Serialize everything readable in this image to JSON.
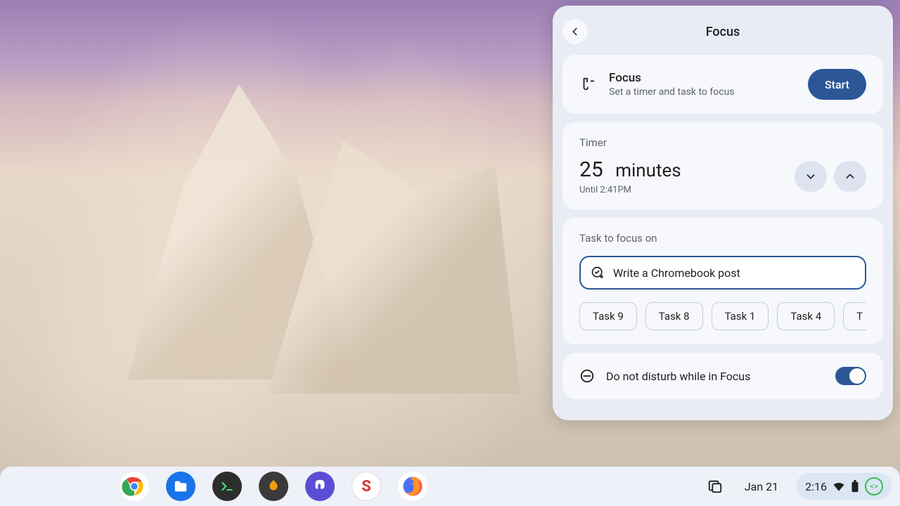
{
  "panel": {
    "title": "Focus"
  },
  "focus": {
    "title": "Focus",
    "subtitle": "Set a timer and task to focus",
    "start_label": "Start"
  },
  "timer": {
    "label": "Timer",
    "value": "25",
    "unit": "minutes",
    "until": "Until 2:41PM"
  },
  "task": {
    "label": "Task to focus on",
    "value": "Write a Chromebook post",
    "chips": [
      "Task 9",
      "Task 8",
      "Task 1",
      "Task 4",
      "T"
    ]
  },
  "dnd": {
    "label": "Do not disturb while in Focus",
    "on": true
  },
  "shelf": {
    "date": "Jan 21",
    "time": "2:16",
    "apps": [
      {
        "name": "chrome",
        "color": "#ffffff"
      },
      {
        "name": "files",
        "color": "#1a73e8"
      },
      {
        "name": "terminal",
        "color": "#2d2d2d"
      },
      {
        "name": "scratch",
        "color": "#3a3a3a"
      },
      {
        "name": "mastodon",
        "color": "#5b4ed6"
      },
      {
        "name": "app-s",
        "color": "#ffffff"
      },
      {
        "name": "firefox",
        "color": "#ffffff"
      }
    ]
  }
}
